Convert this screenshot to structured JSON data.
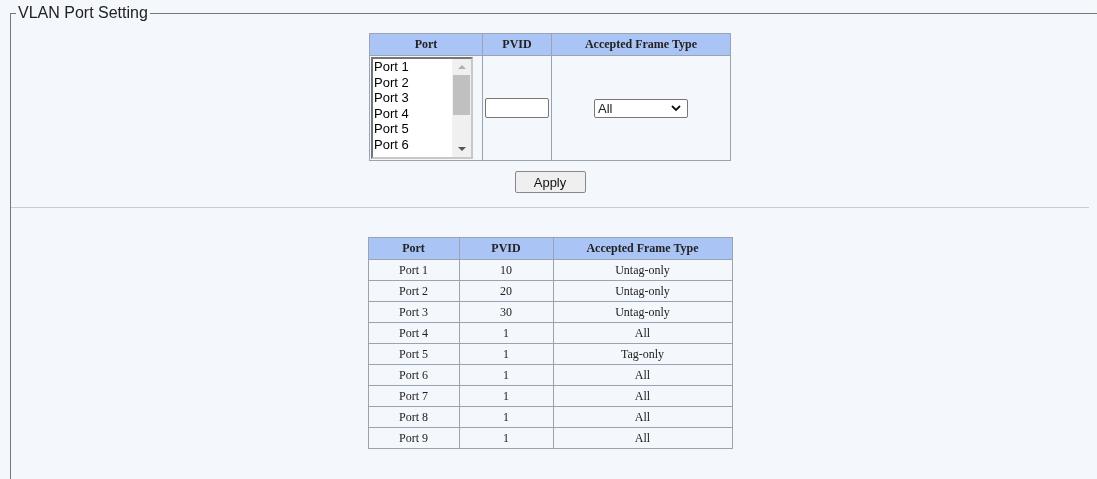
{
  "section": {
    "title": "VLAN Port Setting"
  },
  "form": {
    "columns": [
      "Port",
      "PVID",
      "Accepted Frame Type"
    ],
    "port_list": [
      {
        "label": "Port 1",
        "selected": false
      },
      {
        "label": "Port 2",
        "selected": false
      },
      {
        "label": "Port 3",
        "selected": false
      },
      {
        "label": "Port 4",
        "selected": false
      },
      {
        "label": "Port 5",
        "selected": false
      },
      {
        "label": "Port 6",
        "selected": false
      }
    ],
    "frame_type": {
      "value": "All"
    },
    "apply_button": "Apply"
  },
  "table": {
    "columns": [
      "Port",
      "PVID",
      "Accepted Frame Type"
    ],
    "rows": [
      [
        "Port 1",
        "10",
        "Untag-only"
      ],
      [
        "Port 2",
        "20",
        "Untag-only"
      ],
      [
        "Port 3",
        "30",
        "Untag-only"
      ],
      [
        "Port 4",
        "1",
        "All"
      ],
      [
        "Port 5",
        "1",
        "Tag-only"
      ],
      [
        "Port 6",
        "1",
        "All"
      ],
      [
        "Port 7",
        "1",
        "All"
      ],
      [
        "Port 8",
        "1",
        "All"
      ],
      [
        "Port 9",
        "1",
        "All"
      ]
    ]
  }
}
